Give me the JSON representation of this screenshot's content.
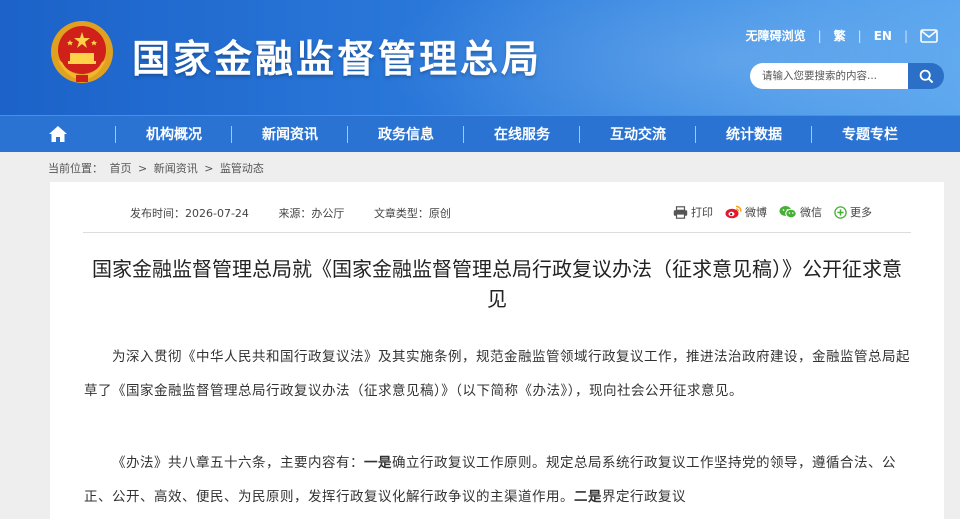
{
  "header": {
    "site_title": "国家金融监督管理总局",
    "links": [
      "无障碍浏览",
      "繁",
      "EN"
    ],
    "search_placeholder": "请输入您要搜索的内容..."
  },
  "nav": {
    "items": [
      "机构概况",
      "新闻资讯",
      "政务信息",
      "在线服务",
      "互动交流",
      "统计数据",
      "专题专栏"
    ]
  },
  "breadcrumb": {
    "prefix": "当前位置：",
    "items": [
      "首页",
      "新闻资讯",
      "监管动态"
    ],
    "sep": ">"
  },
  "article": {
    "publish_time": "发布时间：2026-07-24",
    "source": "来源：办公厅",
    "type": "文章类型：原创",
    "share": [
      "打印",
      "微博",
      "微信",
      "更多"
    ],
    "title": "国家金融监督管理总局就《国家金融监督管理总局行政复议办法（征求意见稿）》公开征求意见",
    "p1": "为深入贯彻《中华人民共和国行政复议法》及其实施条例，规范金融监管领域行政复议工作，推进法治政府建设，金融监管总局起草了《国家金融监督管理总局行政复议办法（征求意见稿）》（以下简称《办法》），现向社会公开征求意见。",
    "p2_a": "《办法》共八章五十六条，主要内容有：",
    "p2_b1": "一是",
    "p2_c": "确立行政复议工作原则。规定总局系统行政复议工作坚持党的领导，遵循合法、公正、公开、高效、便民、为民原则，发挥行政复议化解行政争议的主渠道作用。",
    "p2_b2": "二是",
    "p2_d": "界定行政复议"
  },
  "colors": {
    "header_blue": "#2a78da",
    "nav_blue": "#2a73d2",
    "search_button": "#2b6fc6"
  }
}
